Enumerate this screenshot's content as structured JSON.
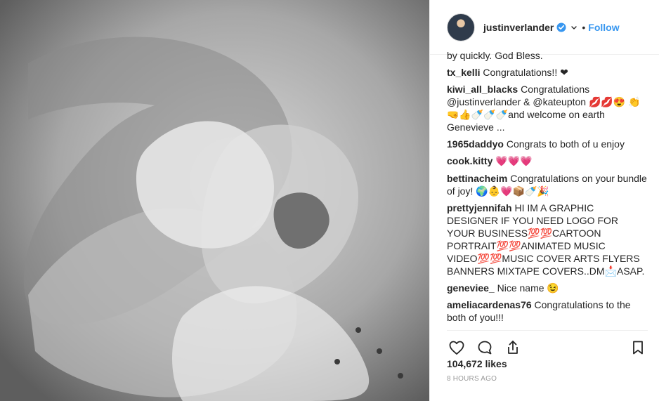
{
  "post": {
    "username": "justinverlander",
    "separator": "•",
    "follow_label": "Follow",
    "likes": "104,672 likes",
    "time": "8 HOURS AGO"
  },
  "comments": [
    {
      "user": "",
      "text": "by quickly. God Bless."
    },
    {
      "user": "tx_kelli",
      "text": "Congratulations!! ❤"
    },
    {
      "user": "kiwi_all_blacks",
      "text": "Congratulations @justinverlander & @kateupton 💋💋😍 👏🤜👍🍼🍼🍼and welcome on earth Genevieve ..."
    },
    {
      "user": "1965daddyo",
      "text": "Congrats to both of u enjoy"
    },
    {
      "user": "cook.kitty",
      "text": "💗💗💗"
    },
    {
      "user": "bettinacheim",
      "text": "Congratulations on your bundle of joy! 🌍👶💗📦🍼🎉"
    },
    {
      "user": "prettyjennifah",
      "text": "HI IM A GRAPHIC DESIGNER IF YOU NEED LOGO FOR YOUR BUSINESS💯💯CARTOON PORTRAIT💯💯ANIMATED MUSIC VIDEO💯💯MUSIC COVER ARTS FLYERS BANNERS MIXTAPE COVERS..DM📩ASAP."
    },
    {
      "user": "geneviee_",
      "text": "Nice name 😉"
    },
    {
      "user": "ameliacardenas76",
      "text": "Congratulations to the both of you!!!"
    }
  ],
  "icons": {
    "like": "heart-icon",
    "comment": "comment-icon",
    "share": "share-icon",
    "save": "bookmark-icon",
    "verified": "verified-badge-icon",
    "more": "chevron-icon"
  },
  "colors": {
    "link": "#3897f0",
    "text": "#262626",
    "muted": "#999999",
    "heart": "#ed4956"
  }
}
